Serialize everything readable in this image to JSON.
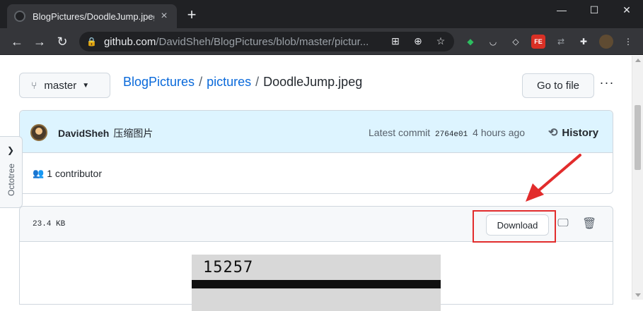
{
  "browser": {
    "tab_title": "BlogPictures/DoodleJump.jpeg",
    "tab_close": "×",
    "new_tab": "+",
    "url_host": "github.com",
    "url_path": "/DavidSheh/BlogPictures/blob/master/pictur...",
    "window_controls": {
      "minimize": "—",
      "maximize": "☐",
      "close": "✕"
    }
  },
  "repo": {
    "branch": "master",
    "breadcrumbs": [
      "BlogPictures",
      "pictures",
      "DoodleJump.jpeg"
    ],
    "separator": "/",
    "go_to_file": "Go to file",
    "more": "···"
  },
  "commit": {
    "author": "DavidSheh",
    "message": "压缩图片",
    "latest_label": "Latest commit",
    "sha": "2764e01",
    "time": "4 hours ago",
    "history_label": "History",
    "contributors": "1 contributor"
  },
  "file": {
    "size": "23.4 KB",
    "download_label": "Download",
    "preview_text": "15257"
  },
  "sidebar": {
    "octotree_label": "Octotree"
  },
  "annotation": {
    "color": "#e22c2c"
  }
}
